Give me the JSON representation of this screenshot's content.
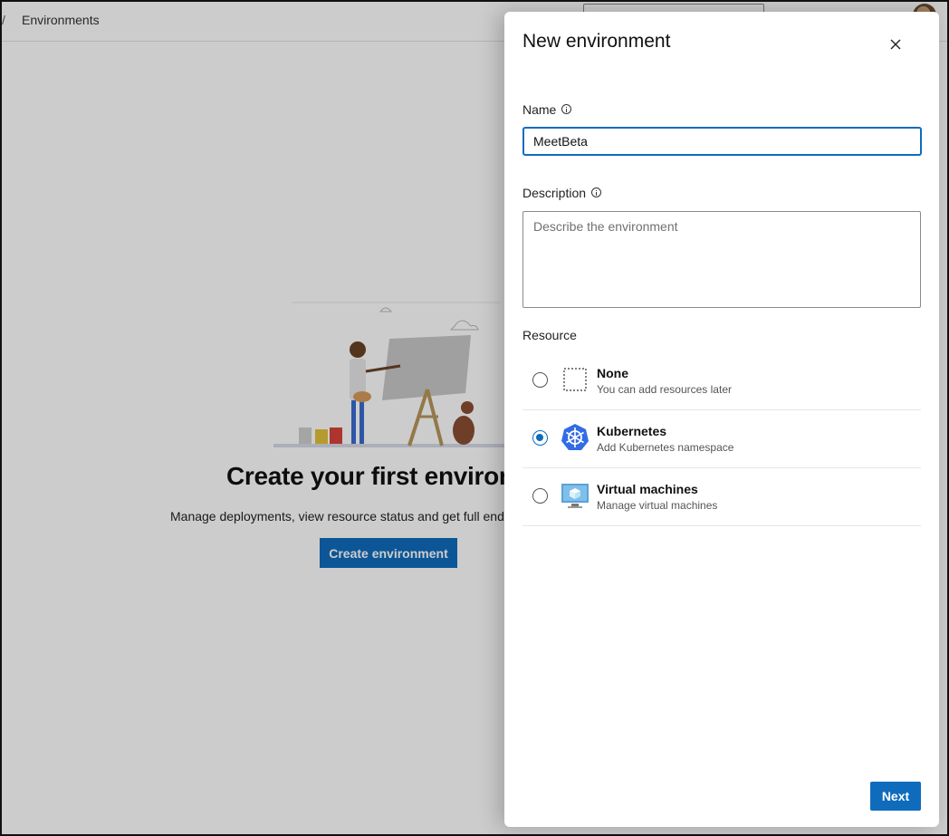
{
  "breadcrumb": {
    "separator": "/",
    "current": "Environments"
  },
  "empty_state": {
    "title": "Create your first environm",
    "description": "Manage deployments, view resource status and get full end",
    "create_button": "Create environment"
  },
  "panel": {
    "title": "New environment",
    "name_label": "Name",
    "name_value": "MeetBeta",
    "description_label": "Description",
    "description_placeholder": "Describe the environment",
    "resource_label": "Resource",
    "resources": [
      {
        "name": "None",
        "sub": "You can add resources later",
        "selected": false,
        "icon": "dotted-box-icon"
      },
      {
        "name": "Kubernetes",
        "sub": "Add Kubernetes namespace",
        "selected": true,
        "icon": "kubernetes-icon"
      },
      {
        "name": "Virtual machines",
        "sub": "Manage virtual machines",
        "selected": false,
        "icon": "virtual-machine-icon"
      }
    ],
    "next_button": "Next"
  },
  "colors": {
    "accent": "#0f6cbd",
    "kubernetes": "#326ce5"
  }
}
